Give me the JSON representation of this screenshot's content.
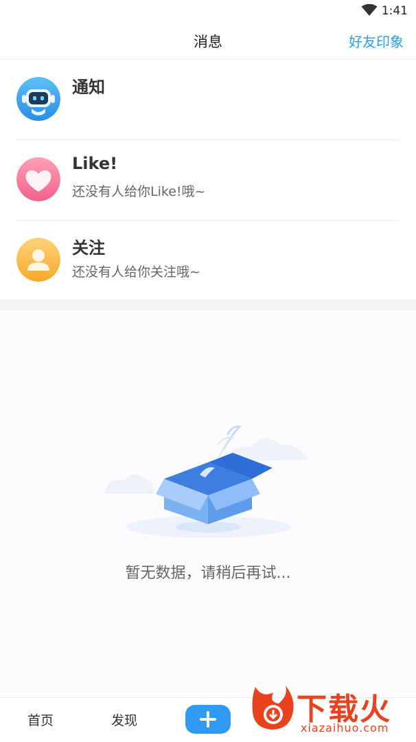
{
  "status_bar": {
    "time": "1:41",
    "wifi_icon": "wifi-icon"
  },
  "header": {
    "title": "消息",
    "action": "好友印象"
  },
  "messages": [
    {
      "title": "通知",
      "subtitle": "",
      "icon": "robot-avatar-icon"
    },
    {
      "title": "Like!",
      "subtitle": "还没有人给你Like!哦~",
      "icon": "heart-avatar-icon"
    },
    {
      "title": "关注",
      "subtitle": "还没有人给你关注哦~",
      "icon": "user-avatar-icon"
    }
  ],
  "empty_state": {
    "text": "暂无数据，请稍后再试...",
    "icon": "empty-box-icon"
  },
  "tabbar": {
    "home": "首页",
    "discover": "发现",
    "add_icon": "plus-icon"
  },
  "watermark": {
    "text": "下载火",
    "url": "xiazaihuo.com"
  },
  "colors": {
    "accent": "#2c9cf5",
    "watermark": "#e8421e"
  }
}
